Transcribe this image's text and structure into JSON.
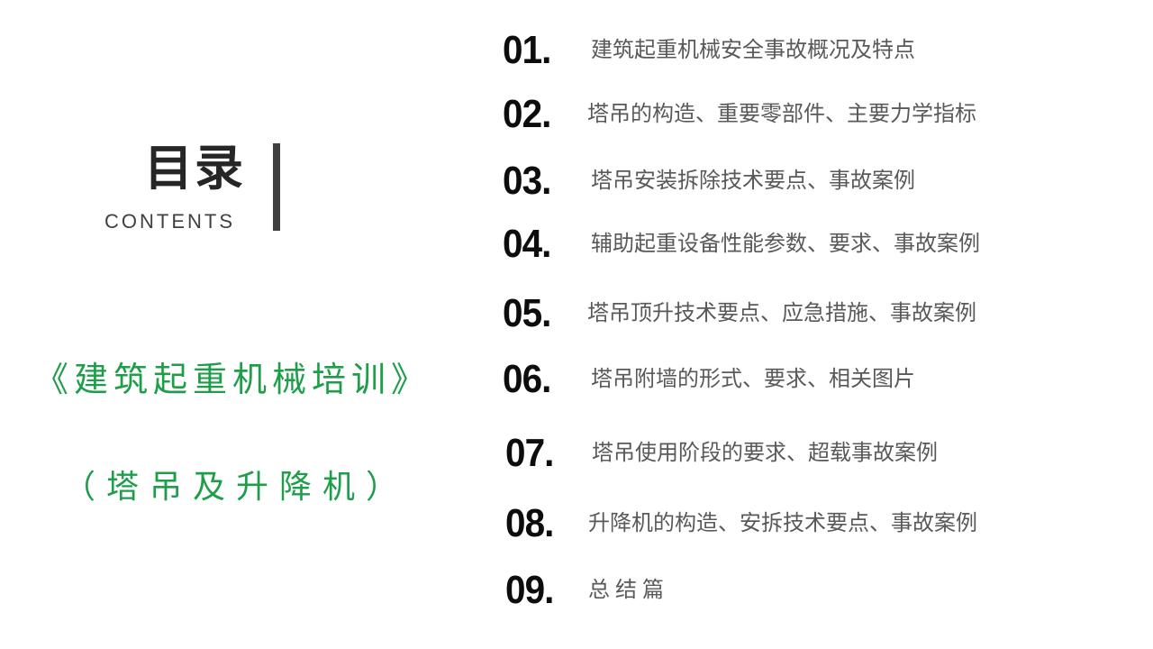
{
  "header": {
    "title": "目录",
    "subtitle": "CONTENTS"
  },
  "course": {
    "title": "《建筑起重机械培训》",
    "subtitle": "（塔吊及升降机）"
  },
  "colors": {
    "accent_green": "#1f9e4a",
    "title_dark": "#262626",
    "bar_gray": "#3f3f3f",
    "item_text": "#595959",
    "number_text": "#0d0d0d"
  },
  "toc": {
    "items": [
      {
        "number": "01.",
        "label": "建筑起重机械安全事故概况及特点"
      },
      {
        "number": "02.",
        "label": "塔吊的构造、重要零部件、主要力学指标"
      },
      {
        "number": "03.",
        "label": "塔吊安装拆除技术要点、事故案例"
      },
      {
        "number": "04.",
        "label": "辅助起重设备性能参数、要求、事故案例"
      },
      {
        "number": "05.",
        "label": "塔吊顶升技术要点、应急措施、事故案例"
      },
      {
        "number": "06.",
        "label": "塔吊附墙的形式、要求、相关图片"
      },
      {
        "number": "07.",
        "label": "塔吊使用阶段的要求、超载事故案例"
      },
      {
        "number": "08.",
        "label": "升降机的构造、安拆技术要点、事故案例"
      },
      {
        "number": "09.",
        "label": "总结篇"
      }
    ]
  }
}
